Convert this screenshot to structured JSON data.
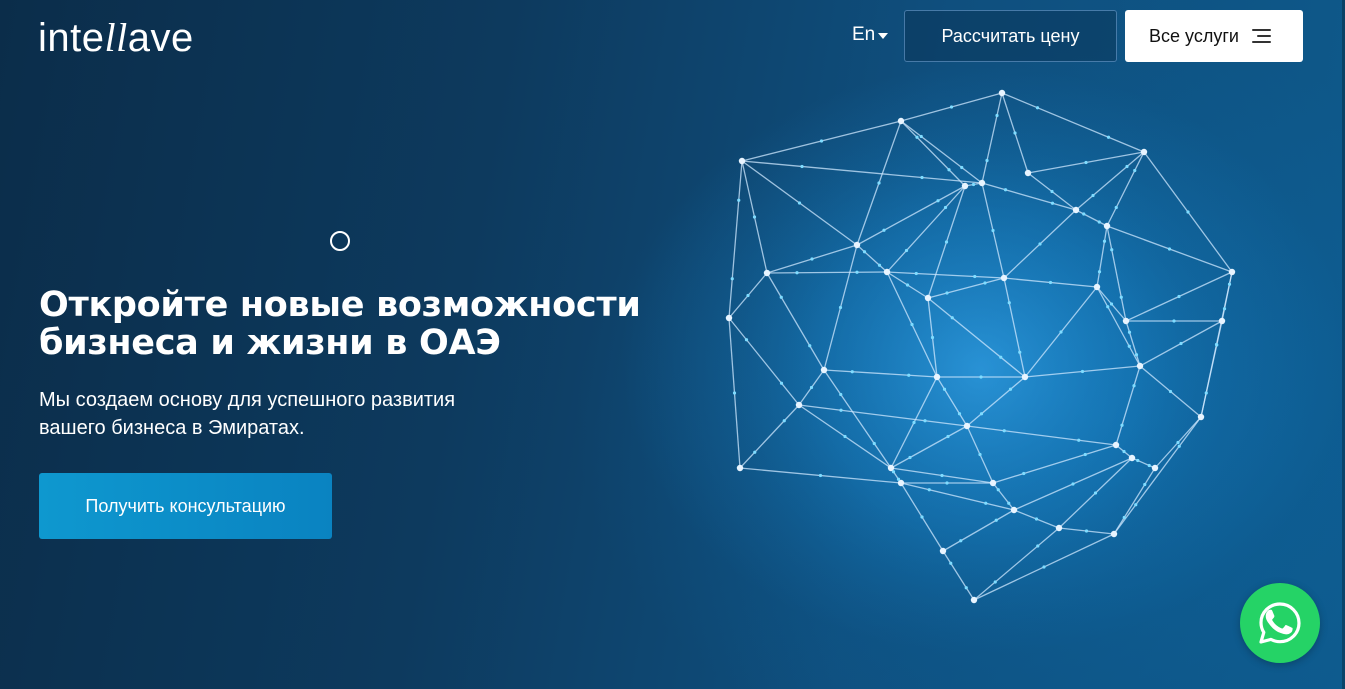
{
  "header": {
    "logo_prefix": "inte",
    "logo_ll": "ll",
    "logo_suffix": "ave",
    "language": "En",
    "calc_button": "Рассчитать цену",
    "services_button": "Все услуги"
  },
  "hero": {
    "headline_line1": "Откройте новые возможности",
    "headline_line2": "бизнеса и жизни в ОАЭ",
    "subtitle_line1": "Мы создаем основу для успешного развития",
    "subtitle_line2": "вашего бизнеса в Эмиратах.",
    "cta_button": "Получить консультацию"
  },
  "icons": {
    "menu": "menu-icon",
    "language_caret": "chevron-down-icon",
    "whatsapp": "whatsapp-icon",
    "cursor": "cursor-ring-icon"
  },
  "colors": {
    "cta_gradient_start": "#0e98cf",
    "cta_gradient_end": "#0a83c1",
    "whatsapp_green": "#25d366",
    "background_dark": "#0b2d4a"
  }
}
